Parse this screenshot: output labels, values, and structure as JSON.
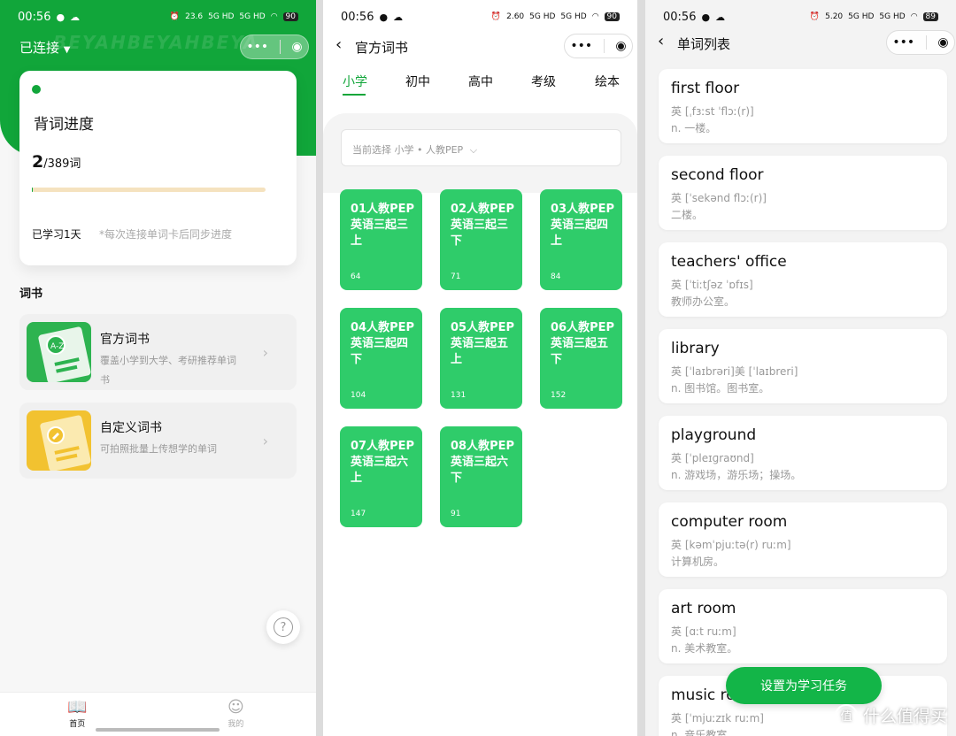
{
  "status": {
    "time": "00:56",
    "battery1": "90",
    "battery2": "90",
    "battery3": "89",
    "net1": "23.6",
    "net2": "2.60",
    "net3": "5.20",
    "net_unit": "KB/s",
    "signal": "5G HD"
  },
  "home": {
    "connection": "已连接",
    "progress_title": "背词进度",
    "learned": "2",
    "total": "/389词",
    "progress": 0.005,
    "days": "已学习1天",
    "sync_hint": "*每次连接单词卡后同步进度",
    "section_title": "词书",
    "books": [
      {
        "name": "官方词书",
        "desc": "覆盖小学到大学、考研推荐单词书",
        "icon": "book-az-icon"
      },
      {
        "name": "自定义词书",
        "desc": "可拍照批量上传想学的单词",
        "icon": "pencil-note-icon"
      }
    ],
    "tabs": [
      {
        "label": "首页",
        "icon": "book-icon"
      },
      {
        "label": "我的",
        "icon": "user-icon"
      }
    ],
    "help": "?",
    "watermark": "BEYAHBEYAHBEYA"
  },
  "books_page": {
    "title": "官方词书",
    "tabs": [
      "小学",
      "初中",
      "高中",
      "考级",
      "绘本"
    ],
    "active_tab": 0,
    "selection": "当前选择 小学 • 人教PEP",
    "items": [
      {
        "name": "01人教PEP 英语三起三上",
        "count": "64"
      },
      {
        "name": "02人教PEP 英语三起三下",
        "count": "71"
      },
      {
        "name": "03人教PEP 英语三起四上",
        "count": "84"
      },
      {
        "name": "04人教PEP 英语三起四下",
        "count": "104"
      },
      {
        "name": "05人教PEP 英语三起五上",
        "count": "131"
      },
      {
        "name": "06人教PEP 英语三起五下",
        "count": "152"
      },
      {
        "name": "07人教PEP 英语三起六上",
        "count": "147"
      },
      {
        "name": "08人教PEP 英语三起六下",
        "count": "91"
      }
    ]
  },
  "words_page": {
    "title": "单词列表",
    "words": [
      {
        "word": "first floor",
        "phon": "英 [ˌfɜːst ˈflɔː(r)]",
        "mean": "n. 一楼。"
      },
      {
        "word": "second floor",
        "phon": "英 [ˈsekənd flɔː(r)]",
        "mean": "二楼。"
      },
      {
        "word": "teachers' office",
        "phon": "英 [ˈtiːtʃəz ˈɒfɪs]",
        "mean": "教师办公室。"
      },
      {
        "word": "library",
        "phon": "英 [ˈlaɪbrəri]美 [ˈlaɪbreri]",
        "mean": "n. 图书馆。图书室。"
      },
      {
        "word": "playground",
        "phon": "英 [ˈpleɪɡraʊnd]",
        "mean": "n. 游戏场，游乐场；操场。"
      },
      {
        "word": "computer room",
        "phon": "英 [kəmˈpjuːtə(r) ruːm]",
        "mean": "计算机房。"
      },
      {
        "word": "art room",
        "phon": "英 [ɑːt ruːm]",
        "mean": "n. 美术教室。"
      },
      {
        "word": "music room",
        "phon": "英 [ˈmjuːzɪk ruːm]",
        "mean": "n. 音乐教室。"
      }
    ],
    "button": "设置为学习任务"
  },
  "watermark_logo": {
    "glyph": "值",
    "text": "什么值得买"
  },
  "colors": {
    "brand_green": "#11a63a",
    "tile_green": "#2fcc6a"
  }
}
